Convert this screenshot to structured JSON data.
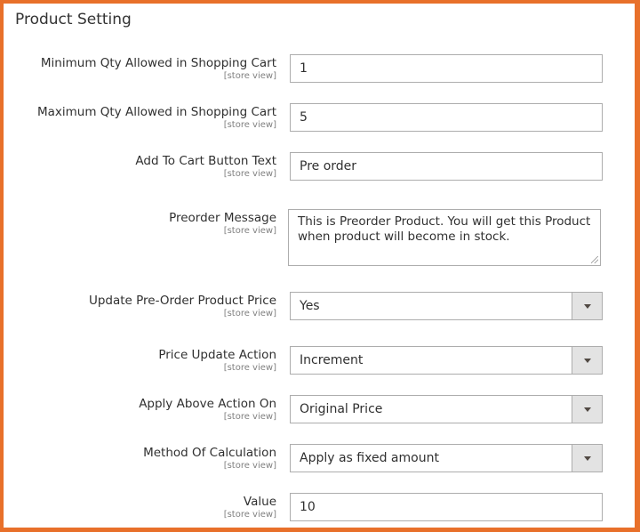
{
  "section_title": "Product Setting",
  "scope_label": "[store view]",
  "fields": [
    {
      "label": "Minimum Qty Allowed in Shopping Cart",
      "value": "1"
    },
    {
      "label": "Maximum Qty Allowed in Shopping Cart",
      "value": "5"
    },
    {
      "label": "Add To Cart Button Text",
      "value": "Pre order"
    },
    {
      "label": "Preorder Message",
      "value": "This is Preorder Product. You will get this Product when product will become in stock."
    },
    {
      "label": "Update Pre-Order Product Price",
      "value": "Yes"
    },
    {
      "label": "Price Update Action",
      "value": "Increment"
    },
    {
      "label": "Apply Above Action On",
      "value": "Original Price"
    },
    {
      "label": "Method Of Calculation",
      "value": "Apply as fixed amount"
    },
    {
      "label": "Value",
      "value": "10"
    }
  ],
  "colors": {
    "frame_border": "#e8702a"
  }
}
